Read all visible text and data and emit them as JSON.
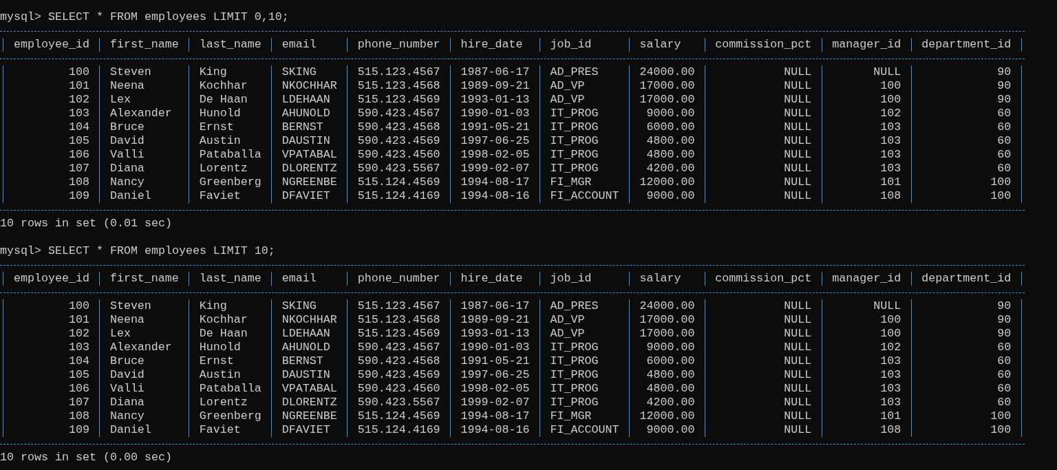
{
  "queries": [
    {
      "prompt": "mysql>",
      "command": "SELECT * FROM employees LIMIT 0,10;",
      "columns": [
        "employee_id",
        "first_name",
        "last_name",
        "email",
        "phone_number",
        "hire_date",
        "job_id",
        "salary",
        "commission_pct",
        "manager_id",
        "department_id"
      ],
      "rows": [
        [
          "100",
          "Steven",
          "King",
          "SKING",
          "515.123.4567",
          "1987-06-17",
          "AD_PRES",
          "24000.00",
          "NULL",
          "NULL",
          "90"
        ],
        [
          "101",
          "Neena",
          "Kochhar",
          "NKOCHHAR",
          "515.123.4568",
          "1989-09-21",
          "AD_VP",
          "17000.00",
          "NULL",
          "100",
          "90"
        ],
        [
          "102",
          "Lex",
          "De Haan",
          "LDEHAAN",
          "515.123.4569",
          "1993-01-13",
          "AD_VP",
          "17000.00",
          "NULL",
          "100",
          "90"
        ],
        [
          "103",
          "Alexander",
          "Hunold",
          "AHUNOLD",
          "590.423.4567",
          "1990-01-03",
          "IT_PROG",
          "9000.00",
          "NULL",
          "102",
          "60"
        ],
        [
          "104",
          "Bruce",
          "Ernst",
          "BERNST",
          "590.423.4568",
          "1991-05-21",
          "IT_PROG",
          "6000.00",
          "NULL",
          "103",
          "60"
        ],
        [
          "105",
          "David",
          "Austin",
          "DAUSTIN",
          "590.423.4569",
          "1997-06-25",
          "IT_PROG",
          "4800.00",
          "NULL",
          "103",
          "60"
        ],
        [
          "106",
          "Valli",
          "Pataballa",
          "VPATABAL",
          "590.423.4560",
          "1998-02-05",
          "IT_PROG",
          "4800.00",
          "NULL",
          "103",
          "60"
        ],
        [
          "107",
          "Diana",
          "Lorentz",
          "DLORENTZ",
          "590.423.5567",
          "1999-02-07",
          "IT_PROG",
          "4200.00",
          "NULL",
          "103",
          "60"
        ],
        [
          "108",
          "Nancy",
          "Greenberg",
          "NGREENBE",
          "515.124.4569",
          "1994-08-17",
          "FI_MGR",
          "12000.00",
          "NULL",
          "101",
          "100"
        ],
        [
          "109",
          "Daniel",
          "Faviet",
          "DFAVIET",
          "515.124.4169",
          "1994-08-16",
          "FI_ACCOUNT",
          "9000.00",
          "NULL",
          "108",
          "100"
        ]
      ],
      "result": "10 rows in set (0.01 sec)"
    },
    {
      "prompt": "mysql>",
      "command": "SELECT * FROM employees LIMIT 10;",
      "columns": [
        "employee_id",
        "first_name",
        "last_name",
        "email",
        "phone_number",
        "hire_date",
        "job_id",
        "salary",
        "commission_pct",
        "manager_id",
        "department_id"
      ],
      "rows": [
        [
          "100",
          "Steven",
          "King",
          "SKING",
          "515.123.4567",
          "1987-06-17",
          "AD_PRES",
          "24000.00",
          "NULL",
          "NULL",
          "90"
        ],
        [
          "101",
          "Neena",
          "Kochhar",
          "NKOCHHAR",
          "515.123.4568",
          "1989-09-21",
          "AD_VP",
          "17000.00",
          "NULL",
          "100",
          "90"
        ],
        [
          "102",
          "Lex",
          "De Haan",
          "LDEHAAN",
          "515.123.4569",
          "1993-01-13",
          "AD_VP",
          "17000.00",
          "NULL",
          "100",
          "90"
        ],
        [
          "103",
          "Alexander",
          "Hunold",
          "AHUNOLD",
          "590.423.4567",
          "1990-01-03",
          "IT_PROG",
          "9000.00",
          "NULL",
          "102",
          "60"
        ],
        [
          "104",
          "Bruce",
          "Ernst",
          "BERNST",
          "590.423.4568",
          "1991-05-21",
          "IT_PROG",
          "6000.00",
          "NULL",
          "103",
          "60"
        ],
        [
          "105",
          "David",
          "Austin",
          "DAUSTIN",
          "590.423.4569",
          "1997-06-25",
          "IT_PROG",
          "4800.00",
          "NULL",
          "103",
          "60"
        ],
        [
          "106",
          "Valli",
          "Pataballa",
          "VPATABAL",
          "590.423.4560",
          "1998-02-05",
          "IT_PROG",
          "4800.00",
          "NULL",
          "103",
          "60"
        ],
        [
          "107",
          "Diana",
          "Lorentz",
          "DLORENTZ",
          "590.423.5567",
          "1999-02-07",
          "IT_PROG",
          "4200.00",
          "NULL",
          "103",
          "60"
        ],
        [
          "108",
          "Nancy",
          "Greenberg",
          "NGREENBE",
          "515.124.4569",
          "1994-08-17",
          "FI_MGR",
          "12000.00",
          "NULL",
          "101",
          "100"
        ],
        [
          "109",
          "Daniel",
          "Faviet",
          "DFAVIET",
          "515.124.4169",
          "1994-08-16",
          "FI_ACCOUNT",
          "9000.00",
          "NULL",
          "108",
          "100"
        ]
      ],
      "result": "10 rows in set (0.00 sec)"
    }
  ]
}
